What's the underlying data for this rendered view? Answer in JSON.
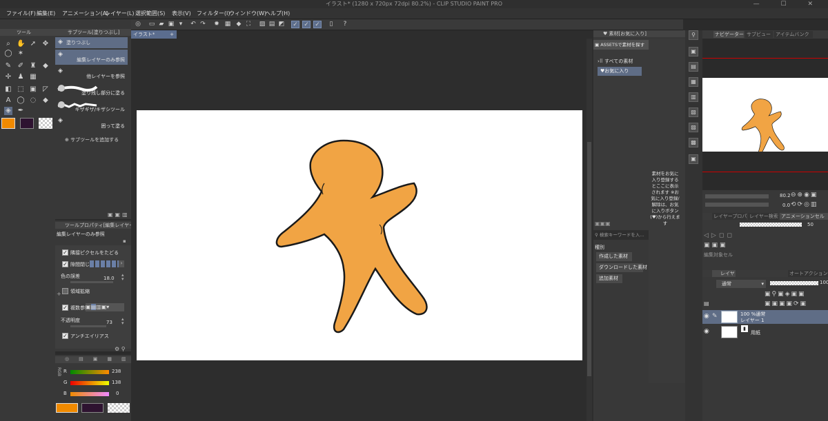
{
  "app": {
    "title": "イラスト* (1280 x 720px 72dpi 80.2%) - CLIP STUDIO PAINT PRO",
    "window_buttons": "— ☐ ✕"
  },
  "menu": [
    "ファイル(F)",
    "編集(E)",
    "アニメーション(A)",
    "レイヤー(L)",
    "選択範囲(S)",
    "表示(V)",
    "フィルター(I)",
    "ウィンドウ(W)",
    "ヘルプ(H)"
  ],
  "tool_panel": {
    "title": "ツール"
  },
  "subtool_panel": {
    "title": "サブツール[塗りつぶし]",
    "items": [
      {
        "label": "塗りつぶし"
      },
      {
        "label": "編集レイヤーのみ参照"
      },
      {
        "label": "他レイヤーを参照"
      },
      {
        "label": "塗り残し部分に塗る"
      },
      {
        "label": "ギザギザ/キザシツール"
      },
      {
        "label": "囲って塗る"
      }
    ],
    "add_label": "サブツールを追加する"
  },
  "tool_property": {
    "title": "ツールプロパティ[編集レイヤーのみ",
    "name": "編集レイヤーのみ参照",
    "props": {
      "adjacent": "隣接ピクセルをたどる",
      "close_gap": "隙間閉じ",
      "color_margin": "色の誤差",
      "color_margin_value": "18.0",
      "area_scaling": "領域拡縮",
      "multi_ref": "複数参照",
      "opacity": "不透明度",
      "opacity_value": "73",
      "antialias": "アンチエイリアス"
    }
  },
  "color_panel": {
    "mode": "RGB",
    "r_label": "R",
    "r_value": "238",
    "g_label": "G",
    "g_value": "138",
    "b_label": "B",
    "b_value": "0",
    "main_color": "#f08a00",
    "sub_color": "#2e1330"
  },
  "document": {
    "tab_label": "イラスト*",
    "add_tab": "+"
  },
  "material_panel": {
    "title": "素材[お気に入り]",
    "assets_button": "ASSETSで素材を探す",
    "tree": [
      {
        "label": "すべての素材"
      },
      {
        "label": "お気に入り"
      }
    ],
    "empty_message": "素材をお気に入り登録するとここに表示されます ※お気に入り登録/解除は、お気に入りボタン(♥)から行えます",
    "search_placeholder": "検索キーワードを入...",
    "category_label": "種別",
    "category_buttons": [
      "作成した素材",
      "ダウンロードした素材",
      "追加素材"
    ]
  },
  "navigator_panel": {
    "tabs": [
      "ナビゲーター",
      "サブビュー",
      "アイテムバンク"
    ],
    "zoom_value": "80.2",
    "rotate_value": "0.0"
  },
  "layer_property": {
    "tabs": [
      "レイヤープロパティ",
      "レイヤー検索",
      "アニメーションセル"
    ],
    "opacity": "50",
    "hint": "編集対象セル"
  },
  "layer_panel": {
    "tabs": [
      "レイヤー",
      "オートアクション"
    ],
    "blend_mode": "通常",
    "opacity": "100",
    "layers": [
      {
        "name1": "100 %通常",
        "name2": "レイヤー 1"
      },
      {
        "name1": "用紙",
        "name2": ""
      }
    ]
  },
  "colors": {
    "accent": "#5f6d86",
    "figure_fill": "#f1a444",
    "figure_stroke": "#1a1a1a",
    "background": "#2b2b2b",
    "canvas": "#ffffff"
  }
}
